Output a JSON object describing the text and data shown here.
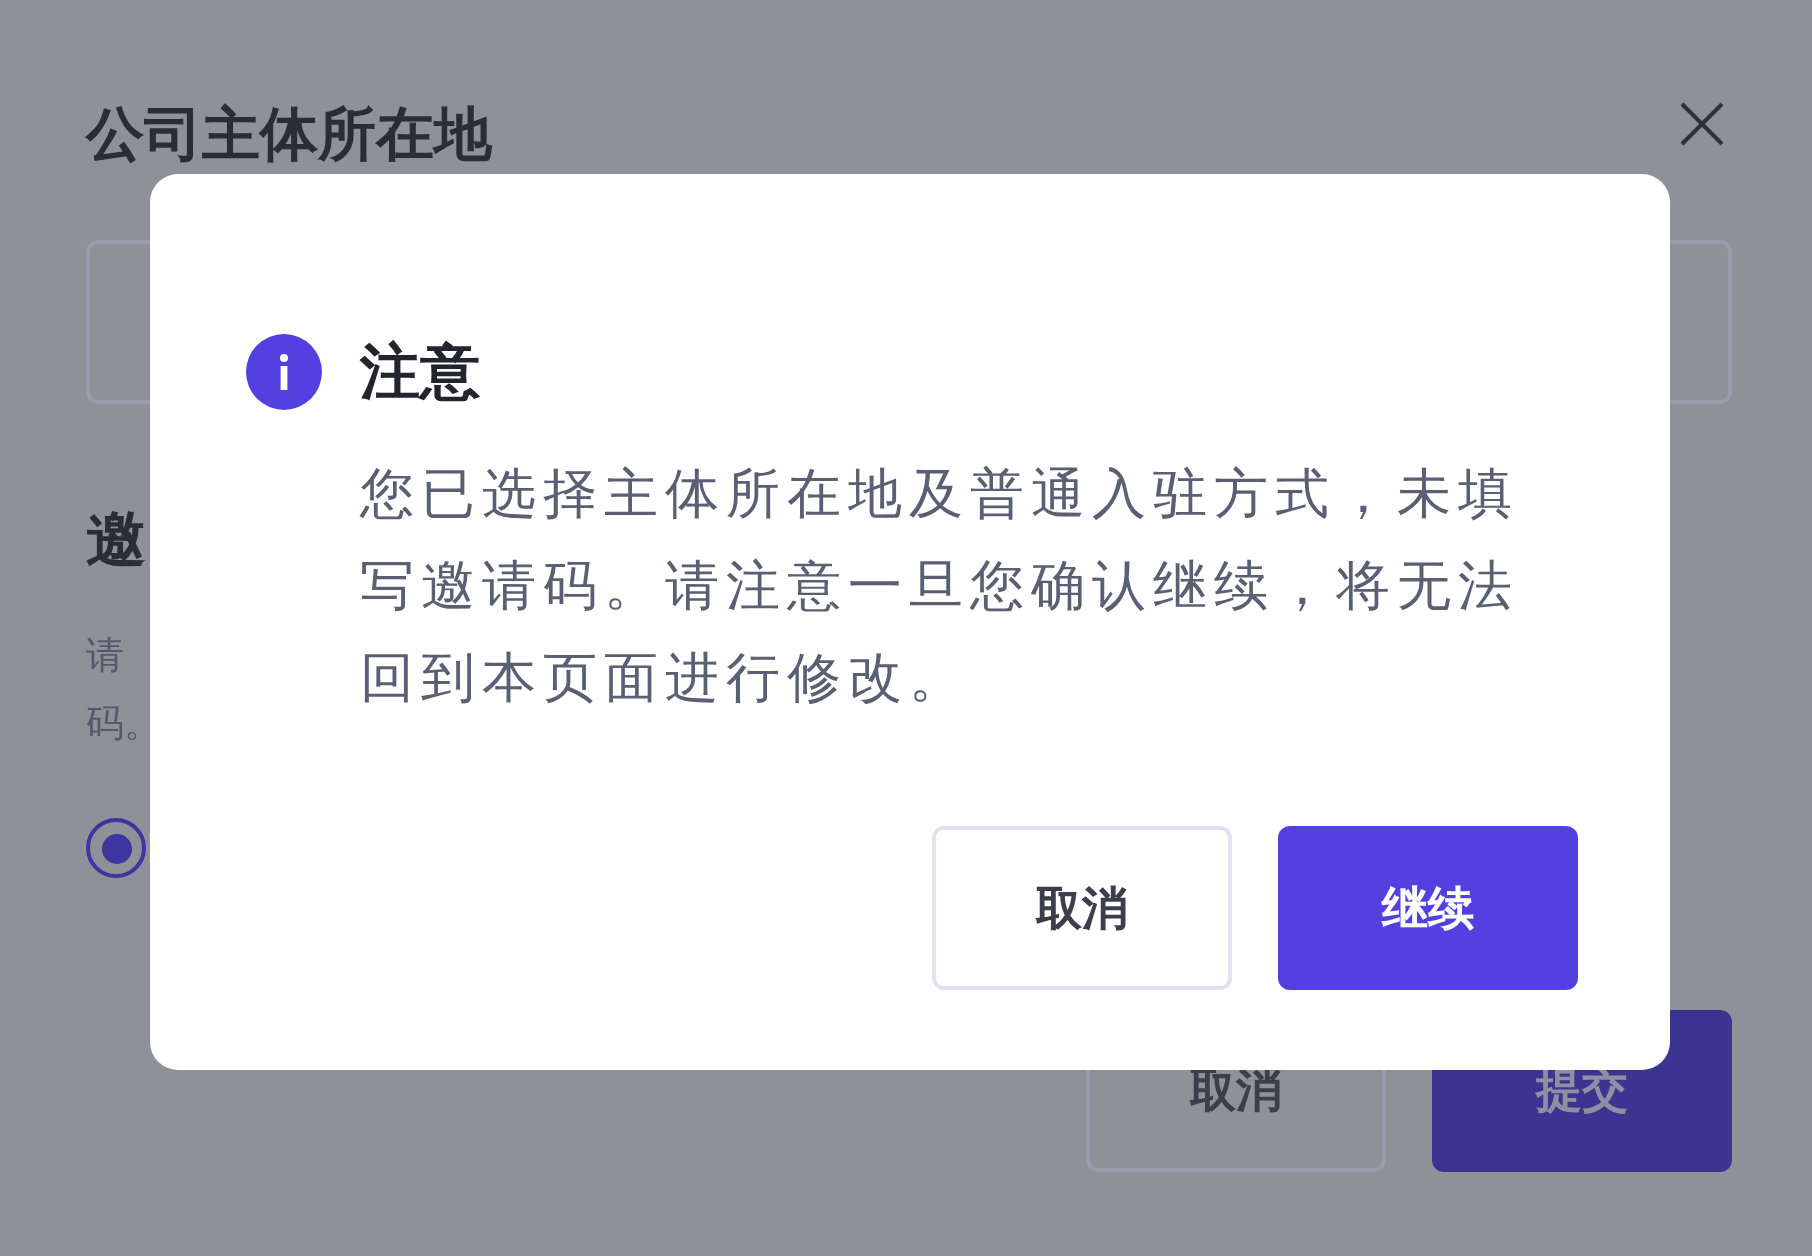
{
  "page": {
    "title": "公司主体所在地",
    "section_heading": "邀",
    "description_lines": [
      "请",
      "码。"
    ],
    "radio": {
      "selected": true
    },
    "buttons": [
      {
        "label": "取消",
        "kind": "secondary"
      },
      {
        "label": "提交",
        "kind": "primary"
      }
    ]
  },
  "dialog": {
    "title": "注意",
    "message": "您已选择主体所在地及普通入驻方式，未填写邀请码。请注意一旦您确认继续，将无法回到本页面进行修改。",
    "buttons": [
      {
        "label": "取消",
        "kind": "secondary"
      },
      {
        "label": "继续",
        "kind": "primary"
      }
    ]
  }
}
